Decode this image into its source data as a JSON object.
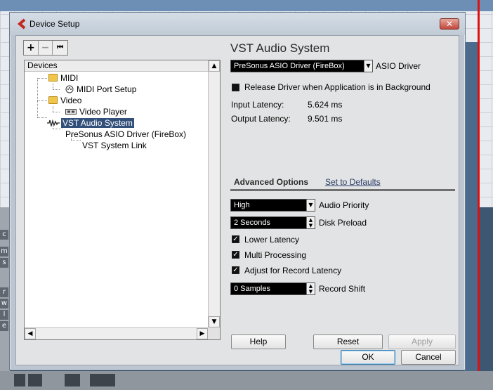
{
  "window": {
    "title": "Device Setup",
    "close_glyph": "✕"
  },
  "toolbar": {
    "add_glyph": "+",
    "remove_glyph": "−",
    "reset_glyph": "⏮"
  },
  "tree": {
    "header": "Devices",
    "nodes": {
      "midi": "MIDI",
      "midi_port_setup": "MIDI Port Setup",
      "video": "Video",
      "video_player": "Video Player",
      "vst_audio_system": "VST Audio System",
      "presonus_driver": "PreSonus ASIO Driver (FireBox)",
      "vst_system_link": "VST System Link"
    }
  },
  "panel": {
    "title": "VST Audio System",
    "asio_driver_value": "PreSonus ASIO Driver (FireBox)",
    "asio_driver_label": "ASIO Driver",
    "release_driver_label": "Release Driver when Application is in Background",
    "release_driver_checked": false,
    "input_latency_label": "Input Latency:",
    "input_latency_value": "5.624 ms",
    "output_latency_label": "Output Latency:",
    "output_latency_value": "9.501 ms",
    "advanced_options_label": "Advanced Options",
    "set_to_defaults_label": "Set to Defaults",
    "audio_priority_value": "High",
    "audio_priority_label": "Audio Priority",
    "disk_preload_value": "2 Seconds",
    "disk_preload_label": "Disk Preload",
    "lower_latency_label": "Lower Latency",
    "lower_latency_checked": true,
    "multi_processing_label": "Multi Processing",
    "multi_processing_checked": true,
    "adjust_record_latency_label": "Adjust for Record Latency",
    "adjust_record_latency_checked": true,
    "record_shift_value": "0 Samples",
    "record_shift_label": "Record Shift",
    "help_label": "Help",
    "reset_label": "Reset",
    "apply_label": "Apply"
  },
  "footer": {
    "ok_label": "OK",
    "cancel_label": "Cancel"
  },
  "background": {
    "left_strip_letters": [
      "c",
      "m",
      "s",
      "r",
      "w",
      "l",
      "e"
    ]
  },
  "colors": {
    "dialog_frame": "#bcc5d0",
    "client_bg": "#e2e3e4",
    "selection": "#33507a",
    "close_button": "#c2473a"
  }
}
